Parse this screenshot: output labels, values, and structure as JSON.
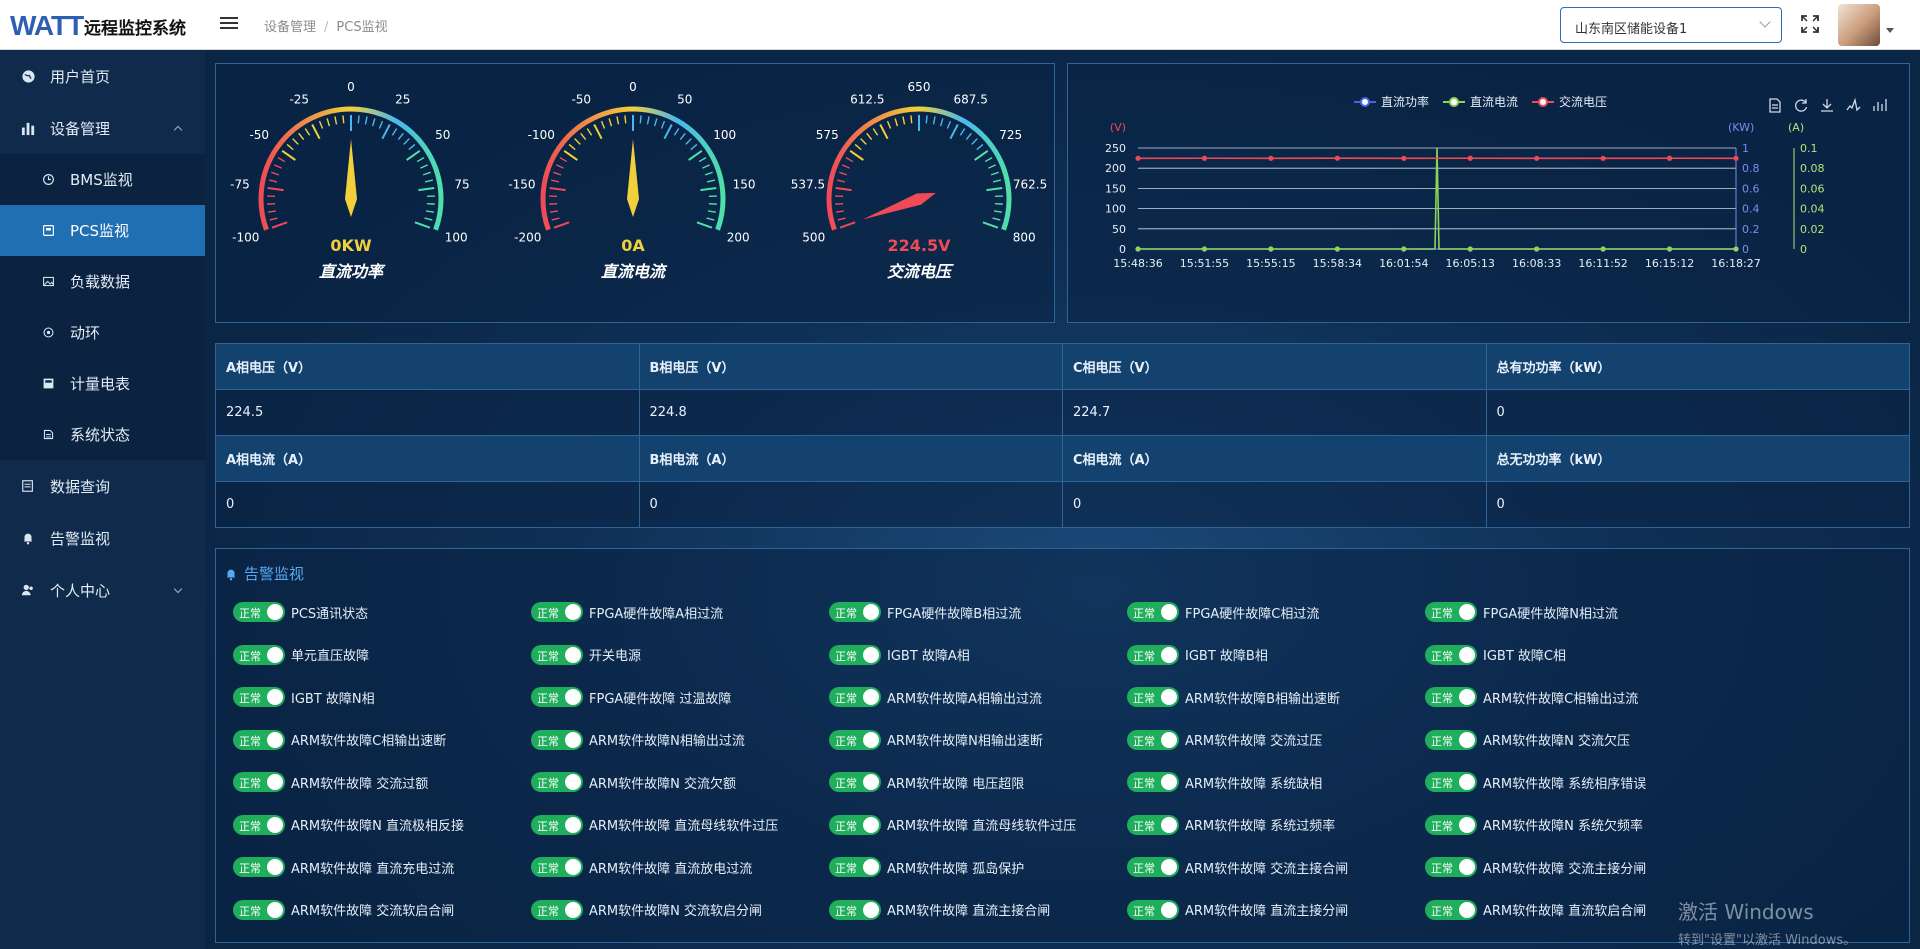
{
  "header": {
    "logo_text": "WATT",
    "app_title": "远程监控系统",
    "breadcrumb": [
      "设备管理",
      "PCS监视"
    ],
    "device_select": "山东南区储能设备1"
  },
  "sidebar": {
    "items": [
      {
        "label": "用户首页",
        "icon": "globe-icon"
      },
      {
        "label": "设备管理",
        "icon": "bar-chart-icon",
        "expanded": true
      },
      {
        "label": "BMS监视",
        "icon": "clock-icon",
        "sub": true
      },
      {
        "label": "PCS监视",
        "icon": "monitor-icon",
        "sub": true,
        "active": true
      },
      {
        "label": "负载数据",
        "icon": "image-icon",
        "sub": true
      },
      {
        "label": "动环",
        "icon": "loop-icon",
        "sub": true
      },
      {
        "label": "计量电表",
        "icon": "meter-icon",
        "sub": true
      },
      {
        "label": "系统状态",
        "icon": "status-icon",
        "sub": true
      },
      {
        "label": "数据查询",
        "icon": "search-doc-icon"
      },
      {
        "label": "告警监视",
        "icon": "bell-icon"
      },
      {
        "label": "个人中心",
        "icon": "user-icon",
        "collapsed": true
      }
    ]
  },
  "gauges": [
    {
      "name": "直流功率",
      "value_text": "0KW",
      "min": -100,
      "max": 100,
      "value": 0,
      "ticks": [
        "-100",
        "-75",
        "-50",
        "-25",
        "0",
        "25",
        "50",
        "75",
        "100"
      ],
      "value_color": "#f2d03b"
    },
    {
      "name": "直流电流",
      "value_text": "0A",
      "min": -200,
      "max": 200,
      "value": 0,
      "ticks": [
        "-200",
        "-150",
        "-100",
        "-50",
        "0",
        "50",
        "100",
        "150",
        "200"
      ],
      "value_color": "#f2d03b"
    },
    {
      "name": "交流电压",
      "value_text": "224.5V",
      "min": 500,
      "max": 800,
      "value": 224.5,
      "ticks": [
        "500",
        "537.5",
        "575",
        "612.5",
        "650",
        "687.5",
        "725",
        "762.5",
        "800"
      ],
      "value_color": "#ef4a56"
    }
  ],
  "chart_data": {
    "type": "line",
    "legend": [
      "直流功率",
      "直流电流",
      "交流电压"
    ],
    "x": [
      "15:48:36",
      "15:51:55",
      "15:55:15",
      "15:58:34",
      "16:01:54",
      "16:05:13",
      "16:08:33",
      "16:11:52",
      "16:15:12",
      "16:18:27"
    ],
    "axes": [
      {
        "unit": "(V)",
        "ticks": [
          "0",
          "50",
          "100",
          "150",
          "200",
          "250"
        ],
        "range": [
          0,
          250
        ],
        "side": "left",
        "color": "#ef4a56"
      },
      {
        "unit": "(KW)",
        "ticks": [
          "0",
          "0.2",
          "0.4",
          "0.6",
          "0.8",
          "1"
        ],
        "range": [
          0,
          1
        ],
        "side": "right",
        "color": "#7b8cf0"
      },
      {
        "unit": "(A)",
        "ticks": [
          "0",
          "0.02",
          "0.04",
          "0.06",
          "0.08",
          "0.1"
        ],
        "range": [
          0,
          0.1
        ],
        "side": "right",
        "color": "#b9e07a"
      }
    ],
    "series": [
      {
        "name": "直流功率",
        "axis": 1,
        "color": "#4a62e6",
        "values": [
          0,
          0,
          0,
          0,
          0,
          0,
          0,
          0,
          0,
          0
        ]
      },
      {
        "name": "直流电流",
        "axis": 2,
        "color": "#8fd35a",
        "values": [
          0,
          0,
          0,
          0,
          0,
          0,
          0,
          0,
          0,
          0
        ],
        "spike_between": [
          4,
          5
        ],
        "spike_value": 0.1
      },
      {
        "name": "交流电压",
        "axis": 0,
        "color": "#ef4a56",
        "values": [
          224.5,
          224.6,
          224.5,
          224.7,
          224.5,
          224.6,
          224.5,
          224.5,
          224.6,
          224.5
        ]
      }
    ]
  },
  "table": {
    "rows": [
      {
        "headers": [
          "A相电压（V）",
          "B相电压（V）",
          "C相电压（V）",
          "总有功功率（kW）"
        ],
        "values": [
          "224.5",
          "224.8",
          "224.7",
          "0"
        ]
      },
      {
        "headers": [
          "A相电流（A）",
          "B相电流（A）",
          "C相电流（A）",
          "总无功功率（kW）"
        ],
        "values": [
          "0",
          "0",
          "0",
          "0"
        ]
      }
    ]
  },
  "alarms": {
    "title": "告警监视",
    "status_label": "正常",
    "items": [
      "PCS通讯状态",
      "FPGA硬件故障A相过流",
      "FPGA硬件故障B相过流",
      "FPGA硬件故障C相过流",
      "FPGA硬件故障N相过流",
      "单元直压故障",
      "开关电源",
      "IGBT 故障A相",
      "IGBT 故障B相",
      "IGBT 故障C相",
      "IGBT 故障N相",
      "FPGA硬件故障 过温故障",
      "ARM软件故障A相输出过流",
      "ARM软件故障B相输出速断",
      "ARM软件故障C相输出过流",
      "ARM软件故障C相输出速断",
      "ARM软件故障N相输出过流",
      "ARM软件故障N相输出速断",
      "ARM软件故障 交流过压",
      "ARM软件故障N 交流欠压",
      "ARM软件故障 交流过额",
      "ARM软件故障N 交流欠额",
      "ARM软件故障 电压超限",
      "ARM软件故障 系统缺相",
      "ARM软件故障 系统相序错误",
      "ARM软件故障N 直流极相反接",
      "ARM软件故障 直流母线软件过压",
      "ARM软件故障 直流母线软件过压",
      "ARM软件故障 系统过频率",
      "ARM软件故障N 系统欠频率",
      "ARM软件故障 直流充电过流",
      "ARM软件故障 直流放电过流",
      "ARM软件故障 孤岛保护",
      "ARM软件故障 交流主接合闸",
      "ARM软件故障 交流主接分闸",
      "ARM软件故障 交流软启合闸",
      "ARM软件故障N 交流软启分闸",
      "ARM软件故障 直流主接合闸",
      "ARM软件故障 直流主接分闸",
      "ARM软件故障 直流软启合闸"
    ]
  },
  "watermark": {
    "line1": "激活 Windows",
    "line2": "转到\"设置\"以激活 Windows。"
  }
}
